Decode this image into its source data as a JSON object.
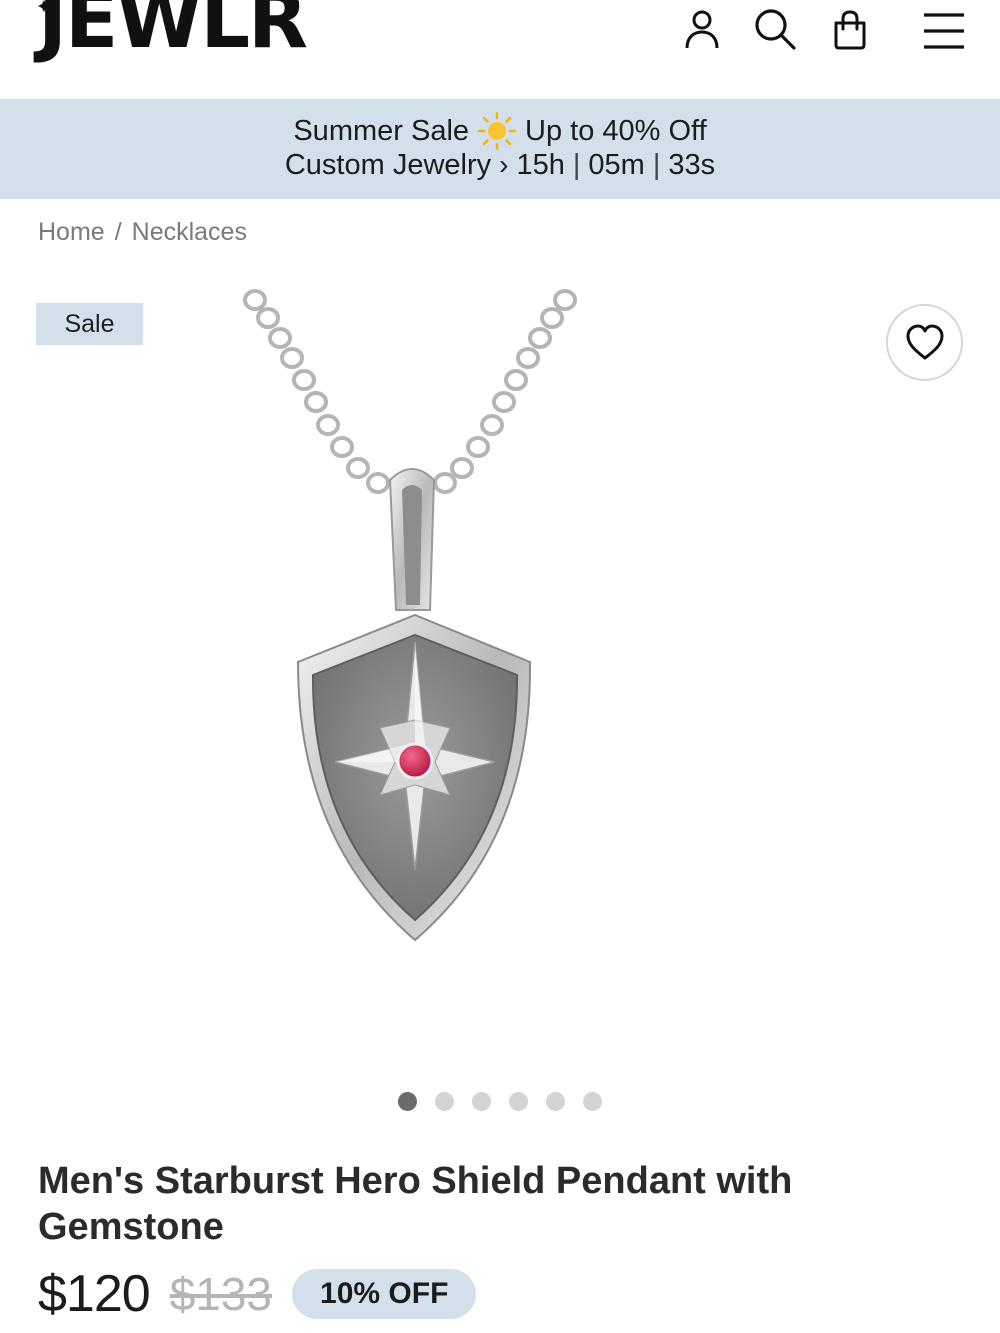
{
  "header": {
    "logo": "JEWLR",
    "icons": [
      "account-icon",
      "search-icon",
      "cart-icon",
      "menu-icon"
    ]
  },
  "banner": {
    "line1_left": "Summer Sale",
    "line1_right": "Up to 40% Off",
    "line2_left": "Custom Jewelry",
    "hours": "15h",
    "minutes": "05m",
    "seconds": "33s",
    "background": "#d3e0ec"
  },
  "breadcrumb": {
    "home": "Home",
    "separator": "/",
    "category": "Necklaces"
  },
  "gallery": {
    "badge": "Sale",
    "dots_total": 6,
    "active_dot": 1
  },
  "product": {
    "title": "Men's Starburst Hero Shield Pendant with Gemstone",
    "price": "$120",
    "original_price": "$133",
    "discount": "10% OFF",
    "gemstone_color": "#c8234f"
  }
}
